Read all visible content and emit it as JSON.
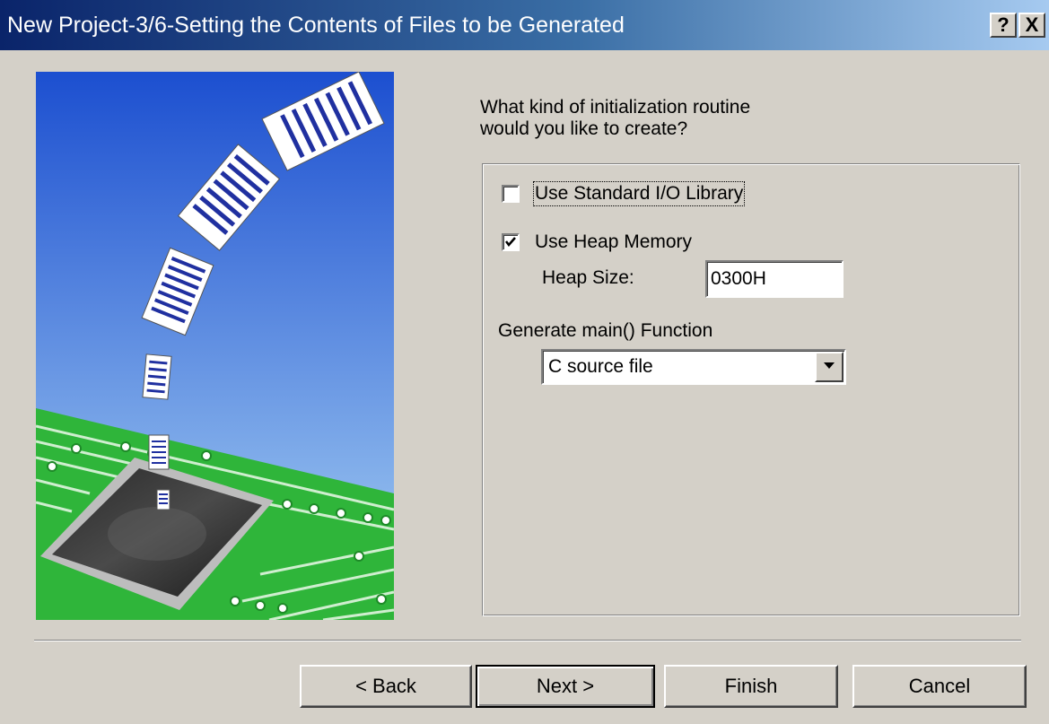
{
  "window": {
    "title": "New Project-3/6-Setting the Contents of Files to be Generated",
    "help_label": "?",
    "close_label": "X"
  },
  "question": {
    "line1": "What kind of initialization routine",
    "line2": "would you like to create?"
  },
  "options": {
    "standard_io": {
      "label": "Use Standard I/O Library",
      "checked": false
    },
    "heap_memory": {
      "label": "Use Heap Memory",
      "checked": true
    },
    "heap_size": {
      "label": "Heap Size:",
      "value": "0300H"
    },
    "main_function": {
      "label": "Generate main() Function",
      "selected": "C source file"
    }
  },
  "buttons": {
    "back": "< Back",
    "next": "Next >",
    "finish": "Finish",
    "cancel": "Cancel"
  },
  "colors": {
    "title_start": "#0a246a",
    "title_end": "#a6caf0",
    "face": "#d4d0c8",
    "sky_top": "#1c4fd0",
    "sky_bottom": "#9ccbf0",
    "board": "#2fb53a"
  }
}
